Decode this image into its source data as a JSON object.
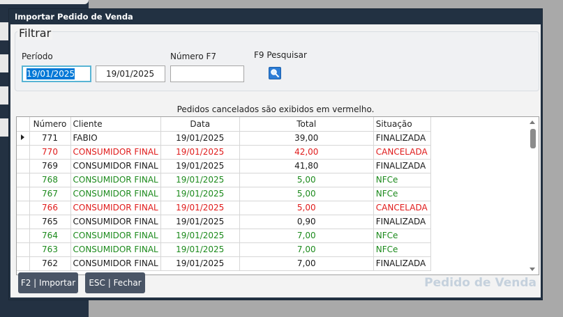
{
  "window": {
    "title": "Importar Pedido de Venda"
  },
  "filter": {
    "legend": "Filtrar",
    "periodo_label": "Período",
    "date_from": "19/01/2025",
    "date_to": "19/01/2025",
    "numero_label": "Número F7",
    "numero_value": "",
    "search_label": "F9 Pesquisar",
    "search_icon": "magnifier-icon"
  },
  "note": "Pedidos cancelados são exibidos em vermelho.",
  "table": {
    "columns": [
      "Número",
      "Cliente",
      "Data",
      "Total",
      "Situação"
    ],
    "rows": [
      {
        "numero": "771",
        "cliente": "FABIO",
        "data": "19/01/2025",
        "total": "39,00",
        "situacao": "FINALIZADA",
        "status": "normal",
        "current": true
      },
      {
        "numero": "770",
        "cliente": "CONSUMIDOR FINAL",
        "data": "19/01/2025",
        "total": "42,00",
        "situacao": "CANCELADA",
        "status": "cancel"
      },
      {
        "numero": "769",
        "cliente": "CONSUMIDOR FINAL",
        "data": "19/01/2025",
        "total": "41,80",
        "situacao": "FINALIZADA",
        "status": "normal"
      },
      {
        "numero": "768",
        "cliente": "CONSUMIDOR FINAL",
        "data": "19/01/2025",
        "total": "5,00",
        "situacao": "NFCe",
        "status": "nfce"
      },
      {
        "numero": "767",
        "cliente": "CONSUMIDOR FINAL",
        "data": "19/01/2025",
        "total": "5,00",
        "situacao": "NFCe",
        "status": "nfce"
      },
      {
        "numero": "766",
        "cliente": "CONSUMIDOR FINAL",
        "data": "19/01/2025",
        "total": "5,00",
        "situacao": "CANCELADA",
        "status": "cancel"
      },
      {
        "numero": "765",
        "cliente": "CONSUMIDOR FINAL",
        "data": "19/01/2025",
        "total": "0,90",
        "situacao": "FINALIZADA",
        "status": "normal"
      },
      {
        "numero": "764",
        "cliente": "CONSUMIDOR FINAL",
        "data": "19/01/2025",
        "total": "7,00",
        "situacao": "NFCe",
        "status": "nfce"
      },
      {
        "numero": "763",
        "cliente": "CONSUMIDOR FINAL",
        "data": "19/01/2025",
        "total": "7,00",
        "situacao": "NFCe",
        "status": "nfce"
      },
      {
        "numero": "762",
        "cliente": "CONSUMIDOR FINAL",
        "data": "19/01/2025",
        "total": "7,00",
        "situacao": "FINALIZADA",
        "status": "normal"
      }
    ]
  },
  "buttons": {
    "importar": "F2 | Importar",
    "fechar": "ESC | Fechar"
  },
  "watermark": "Pedido de Venda",
  "colors": {
    "cancel": "#e01b1b",
    "nfce": "#1c8a1c",
    "normal": "#1a1a1a"
  }
}
